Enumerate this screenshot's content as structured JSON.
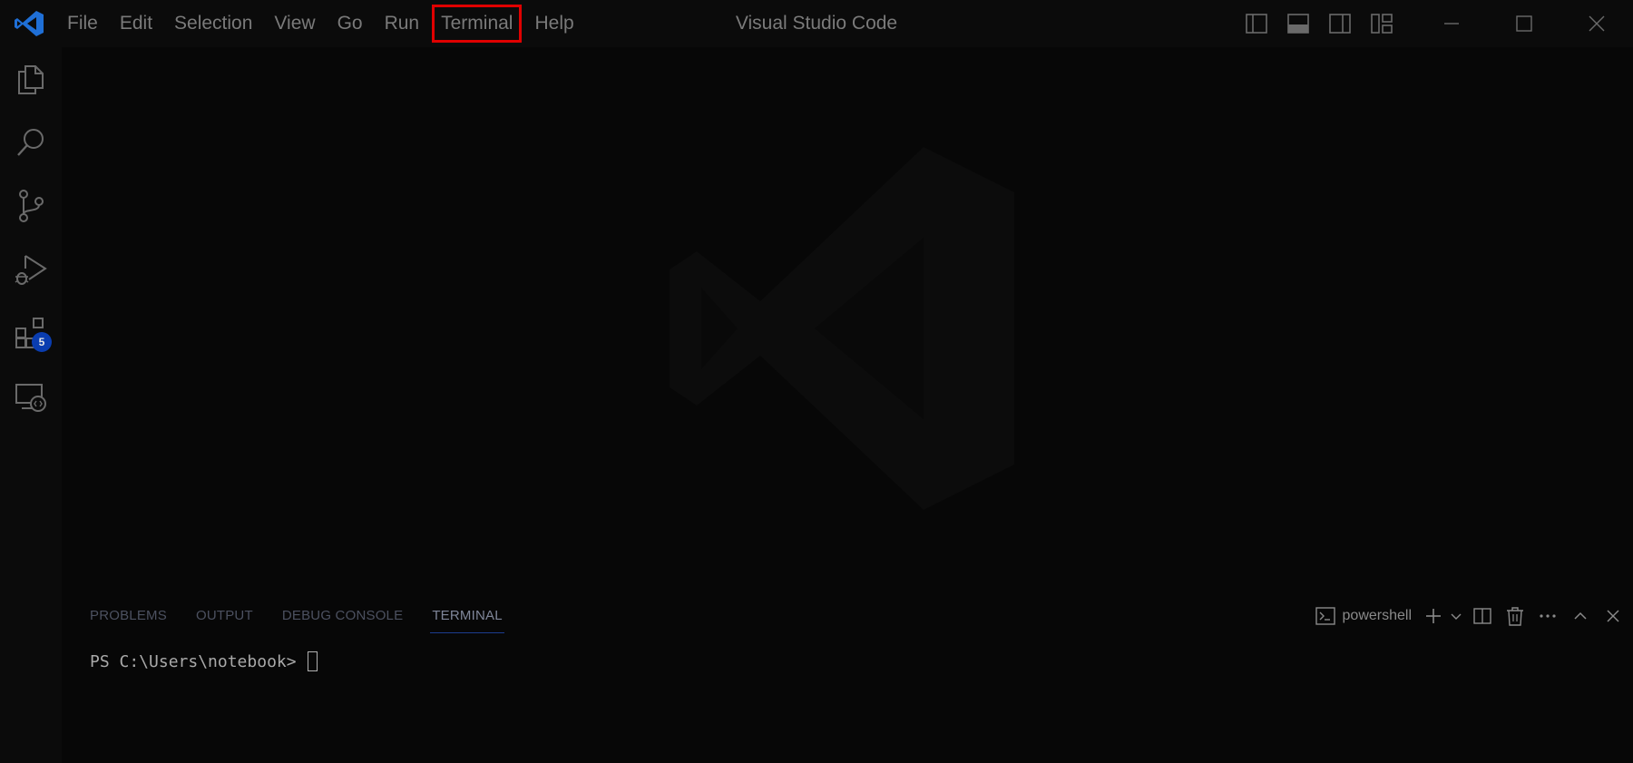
{
  "window": {
    "title": "Visual Studio Code"
  },
  "menu": {
    "items": [
      {
        "label": "File"
      },
      {
        "label": "Edit"
      },
      {
        "label": "Selection"
      },
      {
        "label": "View"
      },
      {
        "label": "Go"
      },
      {
        "label": "Run"
      },
      {
        "label": "Terminal",
        "highlighted": true
      },
      {
        "label": "Help"
      }
    ]
  },
  "title_controls": {
    "icons": [
      "toggle-primary-sidebar-icon",
      "toggle-panel-icon",
      "toggle-secondary-sidebar-icon",
      "customize-layout-icon"
    ],
    "window_buttons": [
      "minimize-icon",
      "maximize-icon",
      "close-icon"
    ]
  },
  "activity_bar": {
    "items": [
      {
        "name": "explorer",
        "icon": "files-icon"
      },
      {
        "name": "search",
        "icon": "search-icon"
      },
      {
        "name": "source-control",
        "icon": "source-control-icon"
      },
      {
        "name": "run-debug",
        "icon": "run-debug-icon"
      },
      {
        "name": "extensions",
        "icon": "extensions-icon",
        "badge": "5"
      },
      {
        "name": "remote-explorer",
        "icon": "remote-explorer-icon"
      }
    ]
  },
  "panel": {
    "tabs": [
      {
        "label": "PROBLEMS",
        "active": false
      },
      {
        "label": "OUTPUT",
        "active": false
      },
      {
        "label": "DEBUG CONSOLE",
        "active": false
      },
      {
        "label": "TERMINAL",
        "active": true
      }
    ],
    "shell": "powershell",
    "actions": [
      "new-terminal-icon",
      "terminal-dropdown-icon",
      "split-terminal-icon",
      "kill-terminal-icon",
      "more-actions-icon",
      "maximize-panel-icon",
      "close-panel-icon"
    ],
    "terminal_prompt": "PS C:\\Users\\notebook>"
  },
  "colors": {
    "background": "#070707",
    "highlight_border": "#e00000",
    "badge": "#0a3db0",
    "logo_blue": "#1f6fd6"
  }
}
